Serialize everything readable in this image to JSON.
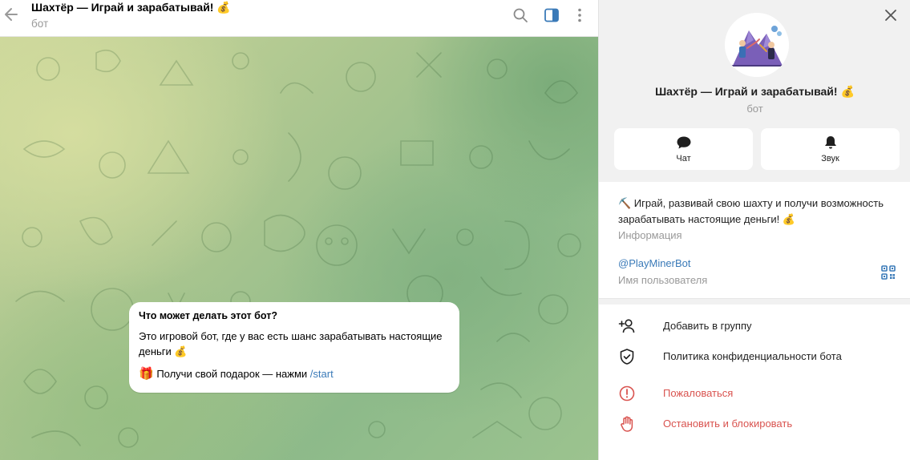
{
  "chat": {
    "title": "Шахтёр — Играй и зарабатывай! 💰",
    "subtitle": "бот"
  },
  "message": {
    "title": "Что может делать этот бот?",
    "text": "Это игровой бот, где у вас есть шанс зарабатывать настоящие деньги 💰",
    "gift_emoji": "🎁",
    "gift_text": "Получи свой подарок — нажми ",
    "command": "/start"
  },
  "panel": {
    "title": "Шахтёр — Играй и зарабатывай! 💰",
    "subtitle": "бот",
    "chat_button": "Чат",
    "sound_button": "Звук",
    "about": "⛏️ Играй, развивай свою шахту и получи возможность зарабатывать настоящие деньги! 💰",
    "about_label": "Информация",
    "username": "@PlayMinerBot",
    "username_label": "Имя пользователя",
    "menu": {
      "add_to_group": "Добавить в группу",
      "privacy_policy": "Политика конфиденциальности бота",
      "report": "Пожаловаться",
      "stop_block": "Остановить и блокировать"
    }
  },
  "icons": {
    "back": "arrow-left-icon",
    "search": "search-icon",
    "side_panel": "sidebar-toggle-icon",
    "more": "more-vertical-icon",
    "close": "close-icon",
    "chat": "chat-bubble-icon",
    "sound": "bell-icon",
    "qr": "qr-code-icon",
    "add_user": "add-user-icon",
    "shield": "shield-check-icon",
    "report": "alert-circle-icon",
    "stop": "hand-stop-icon"
  },
  "colors": {
    "accent": "#3a7ab8",
    "danger": "#d9534f",
    "panel_bg": "#f1f1f1"
  }
}
